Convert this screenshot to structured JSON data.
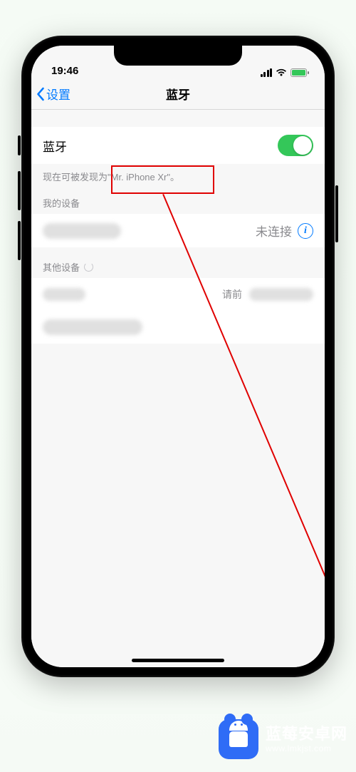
{
  "status_bar": {
    "time": "19:46"
  },
  "nav": {
    "back_label": "设置",
    "title": "蓝牙"
  },
  "bluetooth": {
    "toggle_label": "蓝牙",
    "discoverable_text": "现在可被发现为\"Mr. iPhone Xr\"。"
  },
  "sections": {
    "my_devices_header": "我的设备",
    "other_devices_header": "其他设备"
  },
  "devices": {
    "my": [
      {
        "status": "未连接"
      }
    ]
  },
  "other_hint_fragment": "请前",
  "watermark": {
    "title": "蓝莓安卓网",
    "url": "www.lmkjst.com"
  }
}
